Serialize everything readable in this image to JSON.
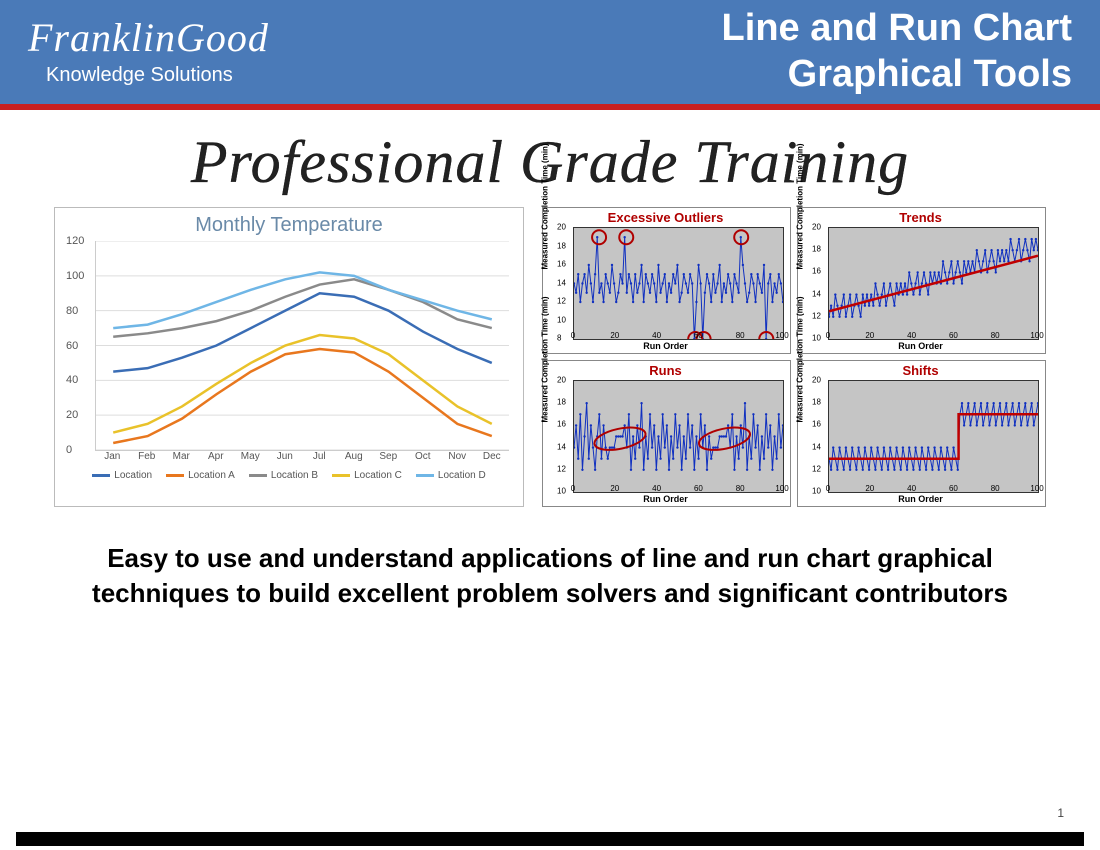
{
  "header": {
    "brand": "FranklinGood",
    "brand_sub": "Knowledge Solutions",
    "title1": "Line and Run Chart",
    "title2": "Graphical Tools"
  },
  "hero": "Professional Grade Training",
  "body_text": "Easy to use and understand applications of line and run chart graphical techniques to build excellent problem solvers and significant contributors",
  "page_number": "1",
  "chart_data": [
    {
      "type": "line",
      "title": "Monthly Temperature",
      "categories": [
        "Jan",
        "Feb",
        "Mar",
        "Apr",
        "May",
        "Jun",
        "Jul",
        "Aug",
        "Sep",
        "Oct",
        "Nov",
        "Dec"
      ],
      "ylim": [
        0,
        120
      ],
      "yticks": [
        0,
        20,
        40,
        60,
        80,
        100,
        120
      ],
      "series": [
        {
          "name": "Location",
          "color": "#3a6db5",
          "values": [
            45,
            47,
            53,
            60,
            70,
            80,
            90,
            88,
            80,
            68,
            58,
            50
          ]
        },
        {
          "name": "Location A",
          "color": "#e8771e",
          "values": [
            4,
            8,
            18,
            32,
            45,
            55,
            58,
            56,
            45,
            30,
            15,
            8
          ]
        },
        {
          "name": "Location B",
          "color": "#8a8a8a",
          "values": [
            65,
            67,
            70,
            74,
            80,
            88,
            95,
            98,
            92,
            85,
            75,
            70
          ]
        },
        {
          "name": "Location C",
          "color": "#e9c22a",
          "values": [
            10,
            15,
            25,
            38,
            50,
            60,
            66,
            64,
            55,
            40,
            25,
            15
          ]
        },
        {
          "name": "Location D",
          "color": "#6fb6e6",
          "values": [
            70,
            72,
            78,
            85,
            92,
            98,
            102,
            100,
            92,
            86,
            80,
            75
          ]
        }
      ]
    },
    {
      "type": "line",
      "title": "Excessive Outliers",
      "xlabel": "Run Order",
      "ylabel": "Measured Completion Time (min)",
      "xlim": [
        0,
        100
      ],
      "ylim": [
        8,
        20
      ],
      "yticks": [
        8,
        10,
        12,
        14,
        16,
        18,
        20
      ],
      "xticks": [
        0,
        20,
        40,
        60,
        80,
        100
      ],
      "outliers_x": [
        12,
        25,
        58,
        62,
        80,
        92
      ],
      "outliers_y": [
        19,
        19,
        8,
        8,
        19,
        8
      ],
      "values": [
        14,
        13,
        15,
        12,
        14,
        15,
        13,
        16,
        14,
        12,
        15,
        19,
        13,
        14,
        12,
        15,
        14,
        13,
        16,
        14,
        12,
        13,
        15,
        14,
        19,
        13,
        15,
        14,
        12,
        15,
        13,
        14,
        16,
        12,
        15,
        14,
        13,
        15,
        14,
        12,
        16,
        13,
        14,
        15,
        12,
        14,
        13,
        15,
        14,
        16,
        12,
        13,
        15,
        14,
        13,
        15,
        14,
        8,
        12,
        16,
        14,
        8,
        13,
        15,
        14,
        12,
        15,
        13,
        14,
        16,
        12,
        14,
        13,
        15,
        14,
        12,
        15,
        14,
        13,
        19,
        16,
        14,
        12,
        13,
        15,
        14,
        12,
        15,
        14,
        13,
        16,
        8,
        14,
        15,
        12,
        14,
        13,
        15,
        14,
        12
      ]
    },
    {
      "type": "line",
      "title": "Trends",
      "xlabel": "Run Order",
      "ylabel": "Measured Completion Time (min)",
      "xlim": [
        0,
        100
      ],
      "ylim": [
        10,
        20
      ],
      "yticks": [
        10,
        12,
        14,
        16,
        18,
        20
      ],
      "xticks": [
        0,
        20,
        40,
        60,
        80,
        100
      ],
      "trend": {
        "start": 12.5,
        "end": 17.5
      },
      "values": [
        12,
        13,
        12,
        14,
        13,
        12,
        13,
        14,
        12,
        13,
        14,
        12,
        13,
        14,
        13,
        12,
        14,
        13,
        14,
        13,
        14,
        13,
        15,
        14,
        13,
        14,
        15,
        13,
        14,
        15,
        14,
        13,
        15,
        14,
        15,
        14,
        15,
        14,
        16,
        15,
        14,
        15,
        16,
        14,
        15,
        16,
        15,
        14,
        16,
        15,
        16,
        15,
        16,
        15,
        17,
        16,
        15,
        16,
        17,
        15,
        16,
        17,
        16,
        15,
        17,
        16,
        17,
        16,
        17,
        16,
        18,
        17,
        16,
        17,
        18,
        16,
        17,
        18,
        17,
        16,
        18,
        17,
        18,
        17,
        18,
        17,
        19,
        18,
        17,
        18,
        19,
        17,
        18,
        19,
        18,
        17,
        19,
        18,
        19,
        18
      ]
    },
    {
      "type": "line",
      "title": "Runs",
      "xlabel": "Run Order",
      "ylabel": "Measured Completion Time (min)",
      "xlim": [
        0,
        100
      ],
      "ylim": [
        10,
        20
      ],
      "yticks": [
        10,
        12,
        14,
        16,
        18,
        20
      ],
      "xticks": [
        0,
        20,
        40,
        60,
        80,
        100
      ],
      "run_regions": [
        {
          "cx": 22,
          "cy": 14.8
        },
        {
          "cx": 72,
          "cy": 14.8
        }
      ],
      "values": [
        14,
        16,
        13,
        17,
        12,
        15,
        18,
        13,
        16,
        14,
        12,
        15,
        17,
        13,
        16,
        14,
        13,
        14,
        14,
        14,
        15,
        15,
        15,
        15,
        16,
        14,
        17,
        12,
        15,
        13,
        16,
        14,
        18,
        12,
        15,
        13,
        17,
        14,
        16,
        12,
        15,
        13,
        17,
        14,
        16,
        12,
        15,
        13,
        17,
        14,
        16,
        12,
        15,
        13,
        17,
        14,
        16,
        12,
        15,
        13,
        17,
        14,
        16,
        12,
        15,
        13,
        14,
        14,
        14,
        15,
        15,
        15,
        15,
        16,
        14,
        17,
        12,
        15,
        13,
        16,
        14,
        18,
        12,
        15,
        13,
        17,
        14,
        16,
        12,
        15,
        13,
        17,
        14,
        16,
        12,
        15,
        13,
        17,
        14,
        16
      ]
    },
    {
      "type": "line",
      "title": "Shifts",
      "xlabel": "Run Order",
      "ylabel": "Measured Completion Time (min)",
      "xlim": [
        0,
        100
      ],
      "ylim": [
        10,
        20
      ],
      "yticks": [
        10,
        12,
        14,
        16,
        18,
        20
      ],
      "xticks": [
        0,
        20,
        40,
        60,
        80,
        100
      ],
      "shift_levels": {
        "before": 13,
        "after": 17,
        "break": 62
      },
      "values": [
        13,
        12,
        14,
        13,
        12,
        14,
        13,
        12,
        14,
        13,
        12,
        14,
        13,
        12,
        14,
        13,
        12,
        14,
        13,
        12,
        14,
        13,
        12,
        14,
        13,
        12,
        14,
        13,
        12,
        14,
        13,
        12,
        14,
        13,
        12,
        14,
        13,
        12,
        14,
        13,
        12,
        14,
        13,
        12,
        14,
        13,
        12,
        14,
        13,
        12,
        14,
        13,
        12,
        14,
        13,
        12,
        14,
        13,
        12,
        14,
        13,
        12,
        17,
        18,
        16,
        17,
        18,
        16,
        17,
        18,
        16,
        17,
        18,
        16,
        17,
        18,
        16,
        17,
        18,
        16,
        17,
        18,
        16,
        17,
        18,
        16,
        17,
        18,
        16,
        17,
        18,
        16,
        17,
        18,
        16,
        17,
        18,
        16,
        17,
        18
      ]
    }
  ]
}
